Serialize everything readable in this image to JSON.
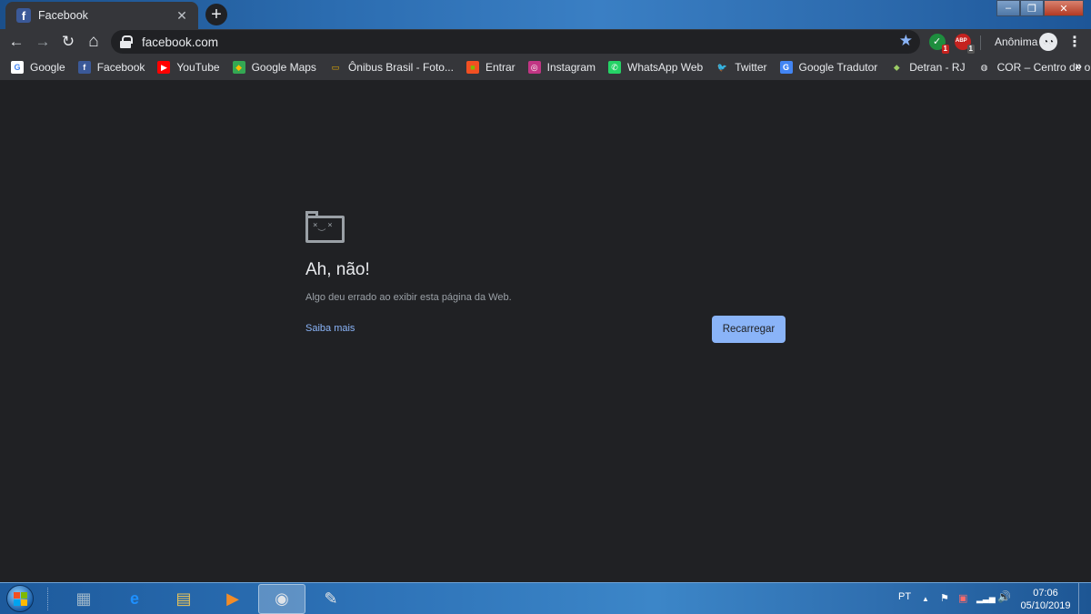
{
  "browser": {
    "tab": {
      "title": "Facebook",
      "close_glyph": "✕",
      "favicon": "f"
    },
    "new_tab_glyph": "+",
    "window_controls": {
      "minimize": "–",
      "maximize": "❐",
      "close": "✕"
    },
    "toolbar": {
      "back_glyph": "←",
      "forward_glyph": "→",
      "reload_glyph": "↻",
      "home_glyph": "⌂",
      "url": "facebook.com",
      "star_glyph": "★",
      "extensions": [
        {
          "name": "shield-extension",
          "badge": "1",
          "color": "#1e8e3e"
        },
        {
          "name": "adblock-extension",
          "label": "ABP",
          "badge": "1",
          "color": "#c5221f"
        }
      ],
      "profile_label": "Anônima",
      "menu_glyph": "⋮"
    },
    "bookmarks": [
      {
        "label": "Google",
        "icon": "google-icon",
        "glyph": "G",
        "color": "#ffffff",
        "fg": "#4285f4"
      },
      {
        "label": "Facebook",
        "icon": "facebook-icon",
        "glyph": "f",
        "color": "#3b5998",
        "fg": "#ffffff"
      },
      {
        "label": "YouTube",
        "icon": "youtube-icon",
        "glyph": "▶",
        "color": "#ff0000",
        "fg": "#ffffff"
      },
      {
        "label": "Google Maps",
        "icon": "maps-icon",
        "glyph": "◆",
        "color": "#34a853",
        "fg": "#fbbc04"
      },
      {
        "label": "Ônibus Brasil - Foto...",
        "icon": "bus-icon",
        "glyph": "▭",
        "color": "#35363a",
        "fg": "#f0b400"
      },
      {
        "label": "Entrar",
        "icon": "microsoft-icon",
        "glyph": "■",
        "color": "#f25022",
        "fg": "#7fba00"
      },
      {
        "label": "Instagram",
        "icon": "instagram-icon",
        "glyph": "◎",
        "color": "#c13584",
        "fg": "#ffffff"
      },
      {
        "label": "WhatsApp Web",
        "icon": "whatsapp-icon",
        "glyph": "✆",
        "color": "#25d366",
        "fg": "#ffffff"
      },
      {
        "label": "Twitter",
        "icon": "twitter-icon",
        "glyph": "🐦",
        "color": "#35363a",
        "fg": "#1da1f2"
      },
      {
        "label": "Google Tradutor",
        "icon": "translate-icon",
        "glyph": "G",
        "color": "#4285f4",
        "fg": "#ffffff"
      },
      {
        "label": "Detran - RJ",
        "icon": "detran-icon",
        "glyph": "⬥",
        "color": "#35363a",
        "fg": "#9ccc65"
      },
      {
        "label": "COR – Centro de o...",
        "icon": "globe-icon",
        "glyph": "◍",
        "color": "#35363a",
        "fg": "#e8eaed"
      }
    ],
    "bookmarks_more_glyph": "»"
  },
  "error_page": {
    "face": "×  ×\n ︶",
    "title": "Ah, não!",
    "description": "Algo deu errado ao exibir esta página da Web.",
    "learn_more": "Saiba mais",
    "reload_button": "Recarregar",
    "accent_color": "#8ab4f8"
  },
  "taskbar": {
    "apps": [
      {
        "name": "calculator-app",
        "glyph": "▦",
        "color": "#9fb7c9",
        "active": false
      },
      {
        "name": "internet-explorer-app",
        "glyph": "e",
        "color": "#1e90ff",
        "active": false
      },
      {
        "name": "file-explorer-app",
        "glyph": "▤",
        "color": "#e8c35a",
        "active": false
      },
      {
        "name": "media-player-app",
        "glyph": "▶",
        "color": "#f28c28",
        "active": false
      },
      {
        "name": "chrome-app",
        "glyph": "◉",
        "color": "#dfe3e8",
        "active": true
      },
      {
        "name": "paint-app",
        "glyph": "✎",
        "color": "#e6e6e6",
        "active": false
      }
    ],
    "language": "PT",
    "tray_up_glyph": "▲",
    "tray_flag_glyph": "⚑",
    "tray_signal_glyph": "▂▃▅",
    "tray_volume_glyph": "🔊",
    "clock": {
      "time": "07:06",
      "date": "05/10/2019"
    }
  }
}
